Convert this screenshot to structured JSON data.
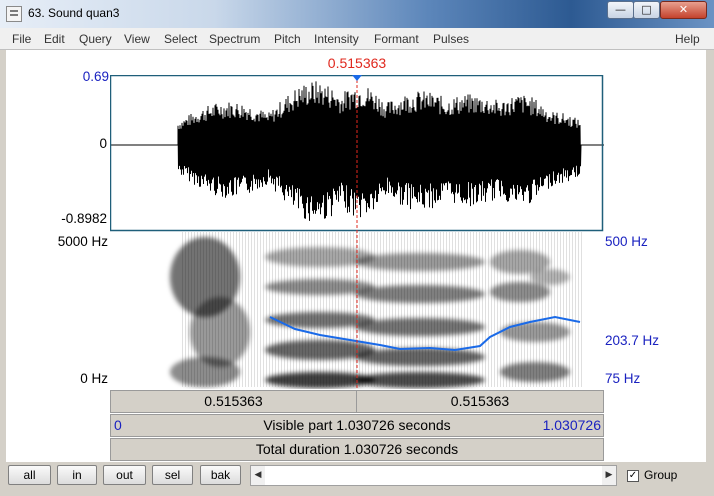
{
  "window": {
    "title": "63. Sound quan3",
    "minimize": "—",
    "maximize": "□",
    "close": "✕"
  },
  "menu": [
    "File",
    "Edit",
    "Query",
    "View",
    "Select",
    "Spectrum",
    "Pitch",
    "Intensity",
    "Formant",
    "Pulses"
  ],
  "menu_help": "Help",
  "cursor": {
    "time": "0.515363",
    "fraction": 0.5
  },
  "waveform": {
    "max_label": "0.69",
    "zero_label": "0",
    "min_label": "-0.8982"
  },
  "spectrogram": {
    "freq_top": "5000 Hz",
    "freq_bottom": "0 Hz",
    "pitch_top": "500 Hz",
    "pitch_value": "203.7 Hz",
    "pitch_bottom": "75 Hz"
  },
  "time_bars": {
    "left_segment": "0.515363",
    "right_segment": "0.515363",
    "visible_start": "0",
    "visible_label": "Visible part 1.030726 seconds",
    "visible_end": "1.030726",
    "total_label": "Total duration 1.030726 seconds"
  },
  "zoom_buttons": [
    "all",
    "in",
    "out",
    "sel",
    "bak"
  ],
  "scrollbar": {
    "left_arrow": "◀",
    "right_arrow": "▶"
  },
  "group": {
    "label": "Group",
    "checked": true,
    "mark": "✓"
  },
  "colors": {
    "cursor": "#e0281e",
    "axis_blue": "#1a22c0",
    "pitch_track": "#1a6ae8",
    "wave_frame": "#1f5f7a"
  }
}
